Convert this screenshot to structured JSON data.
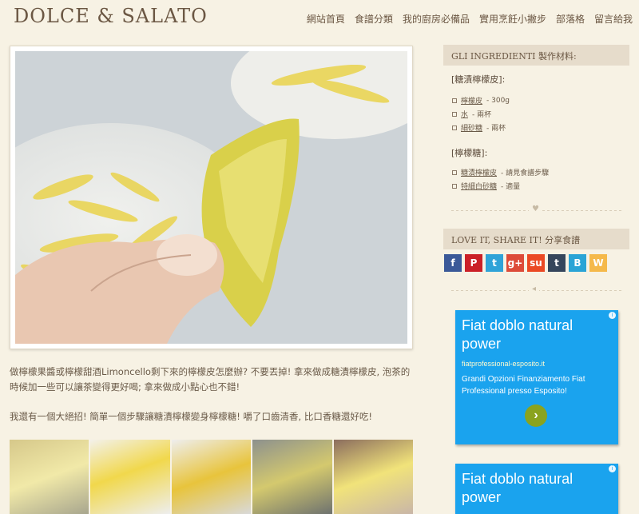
{
  "header": {
    "logo": "DOLCE & SALATO",
    "nav": [
      "網站首頁",
      "食譜分類",
      "我的廚房必備品",
      "實用烹飪小撇步",
      "部落格",
      "留言給我"
    ]
  },
  "main": {
    "para1": "做檸檬果醬或檸檬甜酒Limoncello剩下來的檸檬皮怎麼辦? 不要丟掉! 拿來做成糖漬檸檬皮, 泡茶的時候加一些可以讓茶變得更好喝; 拿來做成小點心也不錯!",
    "para2": "我還有一個大絕招! 簡單一個步驟讓糖漬檸檬變身檸檬糖! 嚼了口齒清香, 比口香糖還好吃!"
  },
  "sidebar": {
    "ingredients_title": "GLI INGREDIENTI 製作材料:",
    "group1": "[糖漬檸檬皮]:",
    "group1_items": [
      {
        "name": "檸檬皮",
        "qty": " - 300g"
      },
      {
        "name": "水",
        "qty": " - 兩杯"
      },
      {
        "name": "細砂糖",
        "qty": " - 兩杯"
      }
    ],
    "group2": "[檸檬糖]:",
    "group2_items": [
      {
        "name": "糖漬檸檬皮",
        "qty": " - 請見食譜步驟"
      },
      {
        "name": "特細白砂糖",
        "qty": " - 適量"
      }
    ],
    "share_title": "LOVE IT, SHARE IT! 分享食譜",
    "share_icons": [
      {
        "label": "f",
        "icon": "facebook-icon",
        "color": "#3b5998"
      },
      {
        "label": "P",
        "icon": "pinterest-icon",
        "color": "#cb2027"
      },
      {
        "label": "t",
        "icon": "twitter-icon",
        "color": "#2fa3d8"
      },
      {
        "label": "g+",
        "icon": "google-plus-icon",
        "color": "#dd4b39"
      },
      {
        "label": "su",
        "icon": "stumbleupon-icon",
        "color": "#eb4924"
      },
      {
        "label": "t",
        "icon": "tumblr-icon",
        "color": "#35465c"
      },
      {
        "label": "B",
        "icon": "blogger-icon",
        "color": "#2aa4d6"
      },
      {
        "label": "W",
        "icon": "weibo-icon",
        "color": "#f5b94a"
      }
    ]
  },
  "ads": [
    {
      "title": "Fiat doblo natural power",
      "url": "fiatprofessional-esposito.it",
      "desc": "Grandi Opzioni Finanziamento Fiat Professional presso Esposito!"
    },
    {
      "title": "Fiat doblo natural power"
    }
  ]
}
